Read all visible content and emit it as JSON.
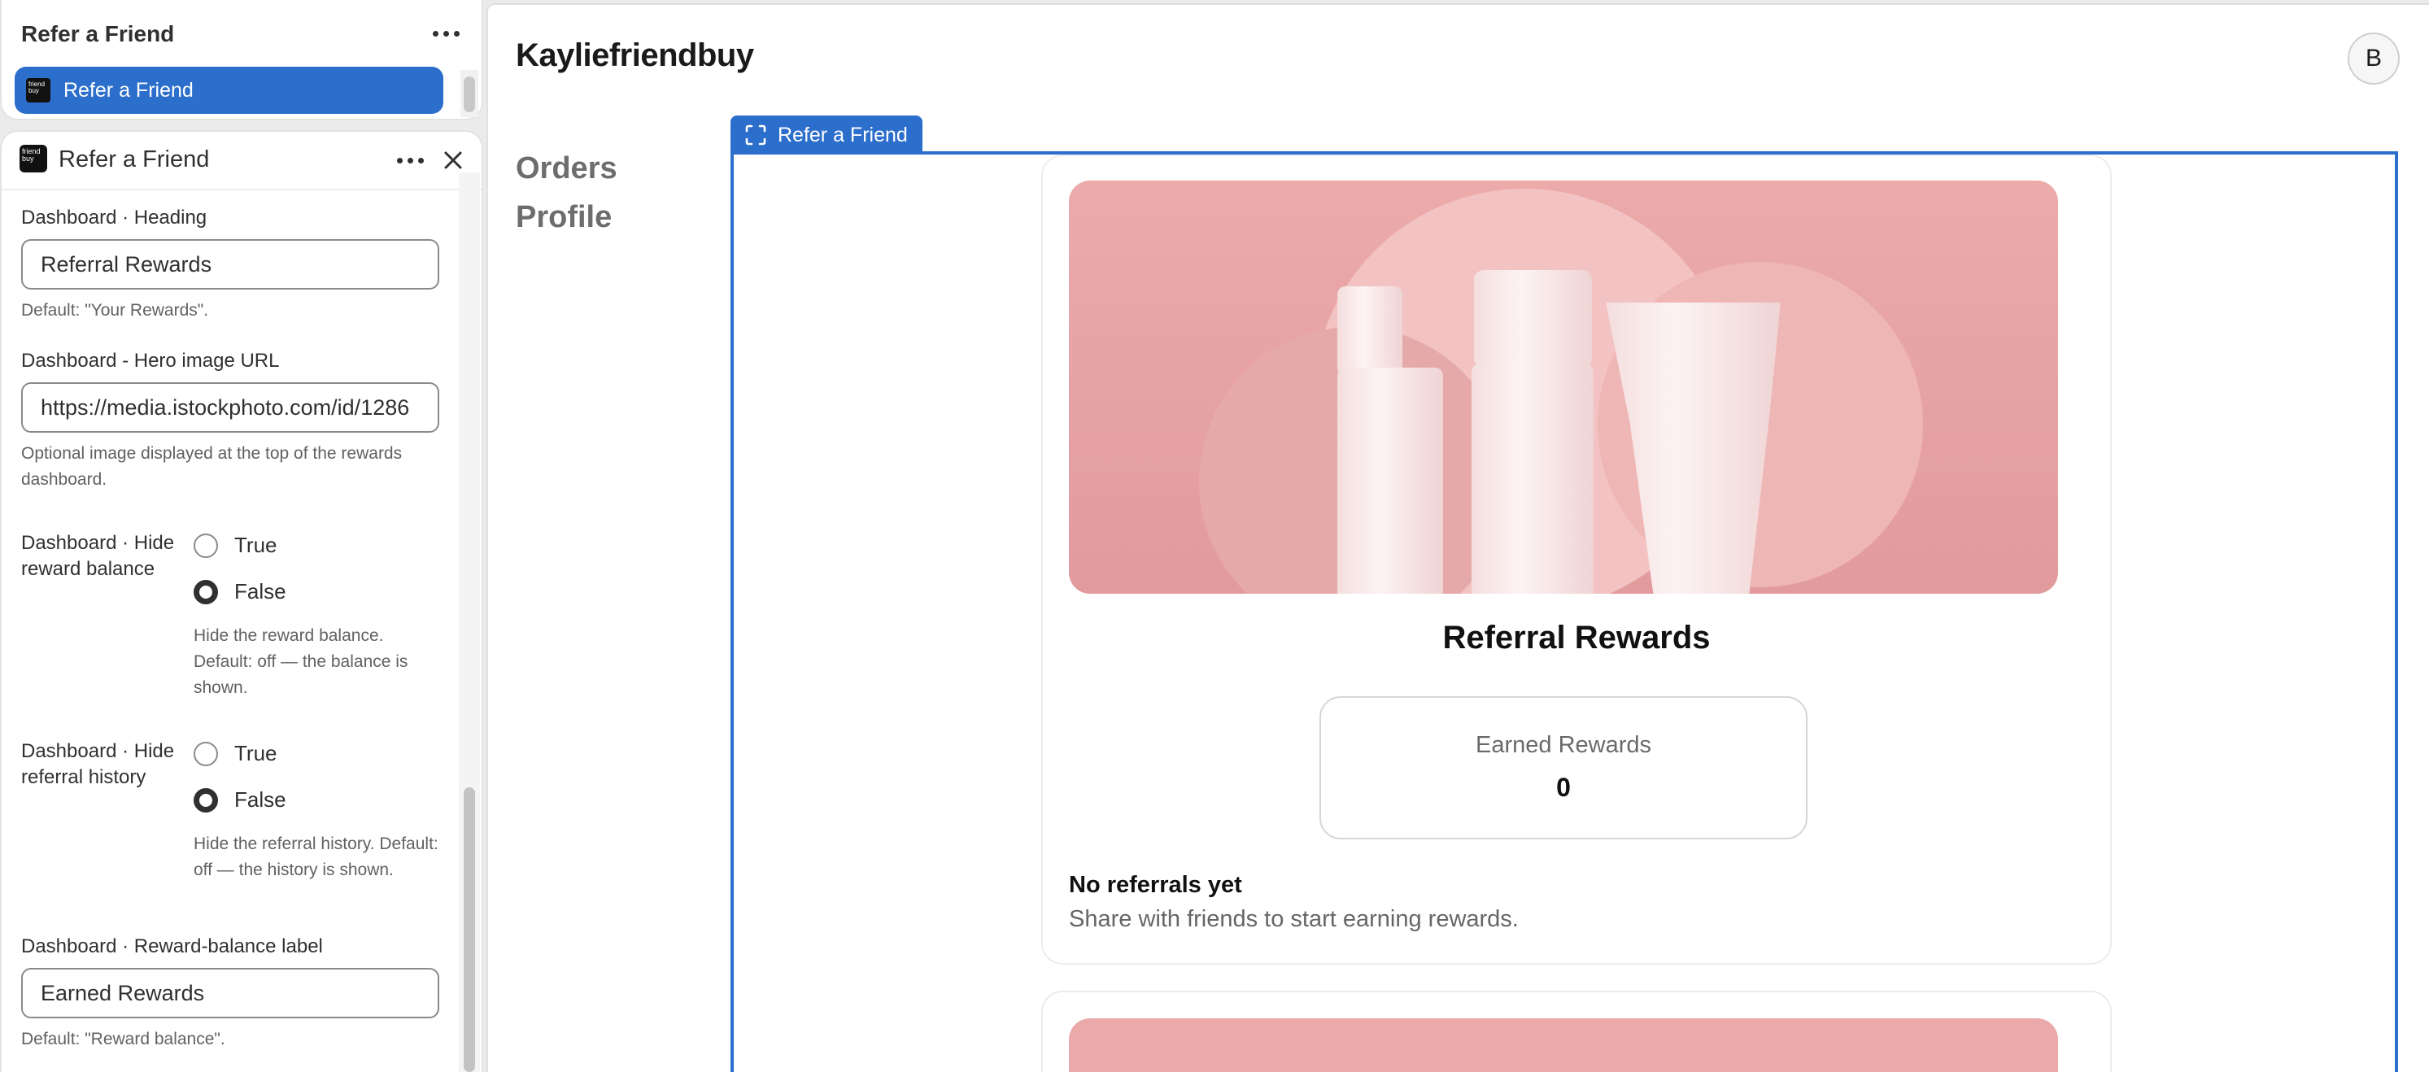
{
  "sidebar": {
    "title": "Refer a Friend",
    "selected_item": "Refer a Friend",
    "app_icon_text": "friend buy"
  },
  "editor": {
    "title": "Refer a Friend",
    "fields": {
      "heading": {
        "label": "Dashboard · Heading",
        "value": "Referral Rewards",
        "help": "Default: \"Your Rewards\"."
      },
      "hero_url": {
        "label": "Dashboard - Hero image URL",
        "value": "https://media.istockphoto.com/id/1286",
        "help": "Optional image displayed at the top of the rewards dashboard."
      },
      "hide_balance": {
        "label": "Dashboard · Hide reward balance",
        "option_true": "True",
        "option_false": "False",
        "selected": "False",
        "help": "Hide the reward balance. Default: off — the balance is shown."
      },
      "hide_history": {
        "label": "Dashboard · Hide referral history",
        "option_true": "True",
        "option_false": "False",
        "selected": "False",
        "help": "Hide the referral history. Default: off — the history is shown."
      },
      "balance_label": {
        "label": "Dashboard · Reward-balance label",
        "value": "Earned Rewards",
        "help": "Default: \"Reward balance\"."
      }
    }
  },
  "preview": {
    "store_name": "Kayliefriendbuy",
    "avatar_initial": "B",
    "nav": [
      "Orders",
      "Profile"
    ],
    "block_tab_label": "Refer a Friend",
    "dashboard": {
      "heading": "Referral Rewards",
      "reward_label": "Earned Rewards",
      "reward_value": "0",
      "empty_title": "No referrals yet",
      "empty_subtitle": "Share with friends to start earning rewards."
    }
  },
  "colors": {
    "accent": "#2c6ecb",
    "hero_pink": "#eba9a9"
  }
}
